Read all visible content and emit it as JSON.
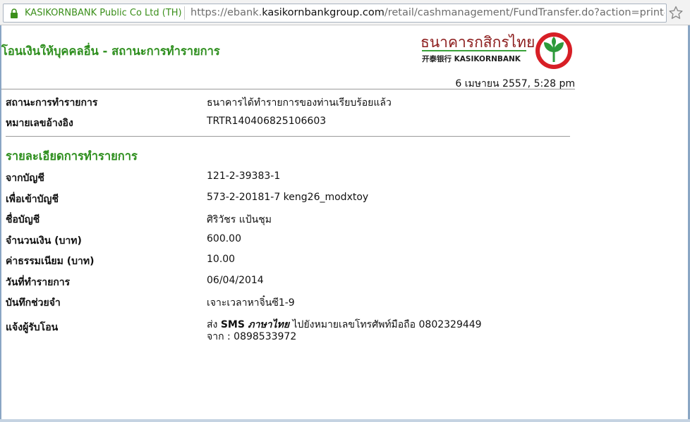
{
  "browser": {
    "site_identity": "KASIKORNBANK Public Co Ltd (TH)",
    "url_prefix": "https://ebank.",
    "url_host": "kasikornbankgroup.com",
    "url_path": "/retail/cashmanagement/FundTransfer.do?action=print&accttyp"
  },
  "header": {
    "title": "โอนเงินให้บุคคลอื่น - สถานะการทำรายการ",
    "brand_thai": "ธนาคารกสิกรไทย",
    "brand_sub": "开泰银行 KASIKORNBANK",
    "datetime": "6 เมษายน 2557, 5:28 pm"
  },
  "status": {
    "status_label": "สถานะการทำรายการ",
    "status_value": "ธนาคารได้ทำรายการของท่านเรียบร้อยแล้ว",
    "ref_label": "หมายเลขอ้างอิง",
    "ref_value": "TRTR140406825106603"
  },
  "details": {
    "section_title": "รายละเอียดการทำรายการ",
    "from_label": "จากบัญชี",
    "from_value": "121-2-39383-1",
    "to_label": "เพื่อเข้าบัญชี",
    "to_value": "573-2-20181-7 keng26_modxtoy",
    "name_label": "ชื่อบัญชี",
    "name_value": "ศิริวัชร แป้นชุม",
    "amount_label": "จำนวนเงิน (บาท)",
    "amount_value": "600.00",
    "fee_label": "ค่าธรรมเนียม (บาท)",
    "fee_value": "10.00",
    "date_label": "วันที่ทำรายการ",
    "date_value": "06/04/2014",
    "memo_label": "บันทึกช่วยจำ",
    "memo_value": "เจาะเวลาหาจิ๋นซี1-9",
    "notify_label": "แจ้งผู้รับโอน",
    "notify_prefix": "ส่ง",
    "notify_sms": "SMS",
    "notify_lang": "ภาษาไทย",
    "notify_rest": "ไปยังหมายเลขโทรศัพท์มือถือ 0802329449",
    "notify_from": "จาก : 0898533972"
  },
  "colors": {
    "title_green": "#2f8f1f",
    "brand_red": "#8b1a1a",
    "logo_red": "#d71f26",
    "logo_green": "#2d9a3a"
  }
}
